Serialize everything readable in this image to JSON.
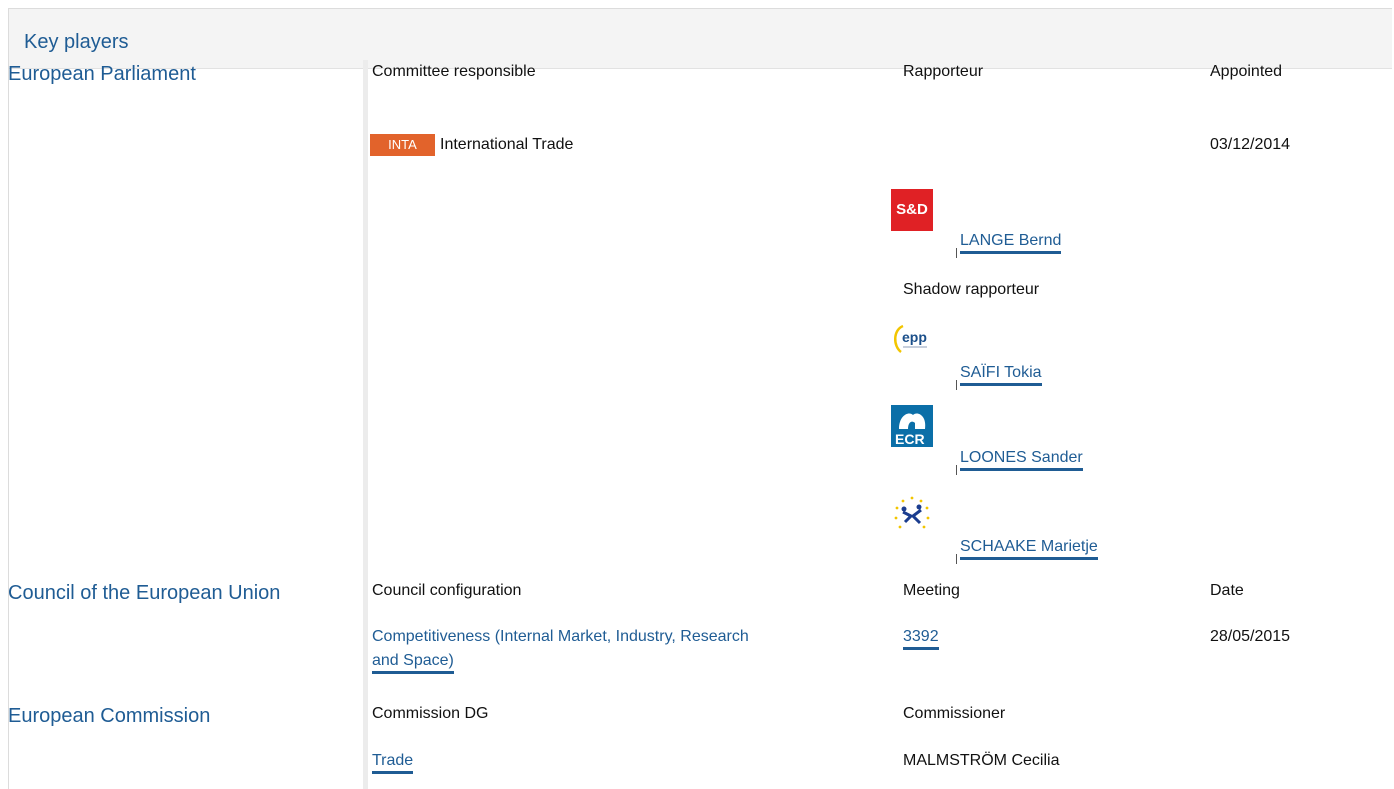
{
  "header": {
    "title": "Key players"
  },
  "parliament": {
    "label": "European Parliament",
    "col_committee": "Committee responsible",
    "col_rapporteur": "Rapporteur",
    "col_appointed": "Appointed",
    "committee_code": "INTA",
    "committee_name": "International Trade",
    "appointed_date": "03/12/2014",
    "rapporteur": {
      "group": "S&D",
      "name": "LANGE Bernd"
    },
    "shadow_label": "Shadow rapporteur",
    "shadows": [
      {
        "group": "EPP",
        "name": "SAÏFI Tokia"
      },
      {
        "group": "ECR",
        "name": "LOONES Sander"
      },
      {
        "group": "ALDE",
        "name": "SCHAAKE Marietje"
      }
    ]
  },
  "council": {
    "label": "Council of the European Union",
    "col_config": "Council configuration",
    "col_meeting": "Meeting",
    "col_date": "Date",
    "config_line1": "Competitiveness (Internal Market, Industry, Research",
    "config_line2": "and Space)",
    "meeting": "3392",
    "date": "28/05/2015"
  },
  "commission": {
    "label": "European Commission",
    "col_dg": "Commission DG",
    "col_commissioner": "Commissioner",
    "dg": "Trade",
    "commissioner": "MALMSTRÖM Cecilia"
  },
  "colors": {
    "accent": "#1f5c94",
    "badge": "#e2632b",
    "sd": "#e02125",
    "ecr": "#0b6fa8"
  }
}
